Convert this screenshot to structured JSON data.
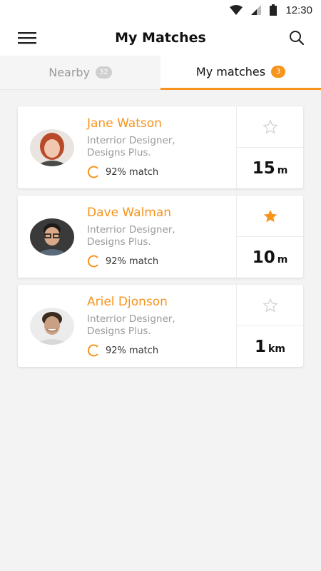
{
  "status_bar": {
    "time": "12:30"
  },
  "app_bar": {
    "title": "My Matches"
  },
  "tabs": [
    {
      "label": "Nearby",
      "count": "32"
    },
    {
      "label": "My matches",
      "count": "3"
    }
  ],
  "colors": {
    "accent": "#f7941d",
    "muted": "#9a9a9a"
  },
  "matches": [
    {
      "name": "Jane Watson",
      "role": "Interrior Designer,",
      "company": "Designs Plus.",
      "match": "92% match",
      "starred": false,
      "distance": "15",
      "unit": "m"
    },
    {
      "name": "Dave Walman",
      "role": "Interrior Designer,",
      "company": "Designs Plus.",
      "match": "92% match",
      "starred": true,
      "distance": "10",
      "unit": "m"
    },
    {
      "name": "Ariel Djonson",
      "role": "Interrior Designer,",
      "company": "Designs Plus.",
      "match": "92% match",
      "starred": false,
      "distance": "1",
      "unit": "km"
    }
  ]
}
